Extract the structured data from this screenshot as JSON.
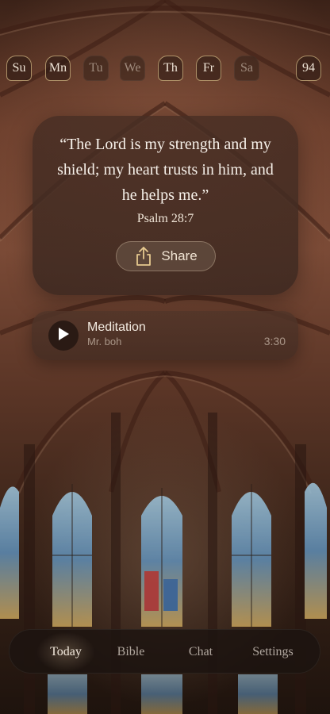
{
  "days": [
    {
      "label": "Su",
      "state": "completed"
    },
    {
      "label": "Mn",
      "state": "completed"
    },
    {
      "label": "Tu",
      "state": "inactive"
    },
    {
      "label": "We",
      "state": "inactive"
    },
    {
      "label": "Th",
      "state": "completed"
    },
    {
      "label": "Fr",
      "state": "completed"
    },
    {
      "label": "Sa",
      "state": "inactive"
    }
  ],
  "streak": {
    "value": "94"
  },
  "verse": {
    "text": "“The Lord is my strength and my shield; my heart trusts in him, and he helps me.”",
    "reference": "Psalm 28:7",
    "share_label": "Share",
    "share_icon": "share-icon"
  },
  "audio": {
    "title": "Meditation",
    "artist": "Mr. boh",
    "duration": "3:30",
    "play_icon": "play-icon"
  },
  "tabs": [
    {
      "label": "Today",
      "active": true
    },
    {
      "label": "Bible",
      "active": false
    },
    {
      "label": "Chat",
      "active": false
    },
    {
      "label": "Settings",
      "active": false
    }
  ],
  "colors": {
    "accent_border": "#d2b482",
    "card_bg": "#4a3026",
    "text_primary": "#f7f1ea",
    "tabbar_bg": "#1c1410"
  }
}
